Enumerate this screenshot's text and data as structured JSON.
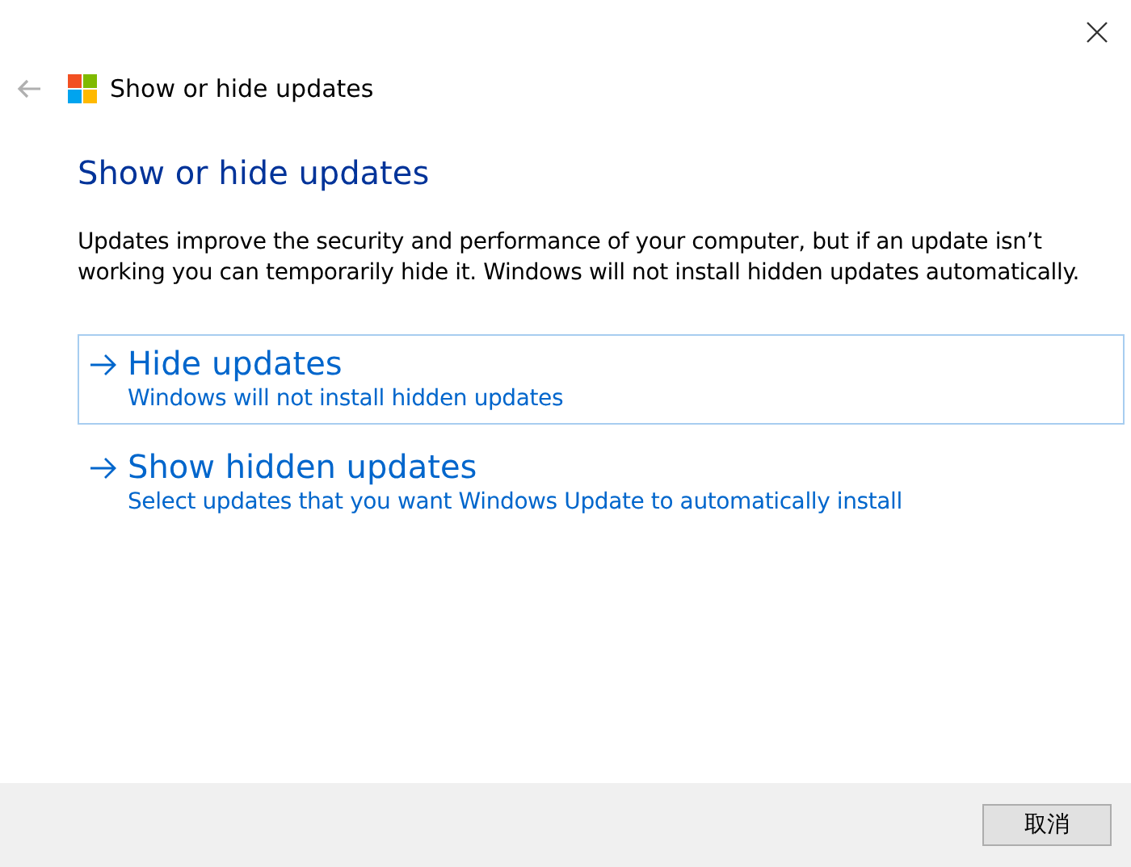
{
  "window": {
    "title": "Show or hide updates",
    "back_disabled": true
  },
  "heading": "Show or hide updates",
  "description": "Updates improve the security and performance of your computer, but if an update isn’t working you can temporarily hide it. Windows will not install hidden updates automatically.",
  "options": [
    {
      "title": "Hide updates",
      "subtitle": "Windows will not install hidden updates",
      "focused": true
    },
    {
      "title": "Show hidden updates",
      "subtitle": "Select updates that you want Windows Update to automatically install",
      "focused": false
    }
  ],
  "buttons": [
    "取消"
  ]
}
